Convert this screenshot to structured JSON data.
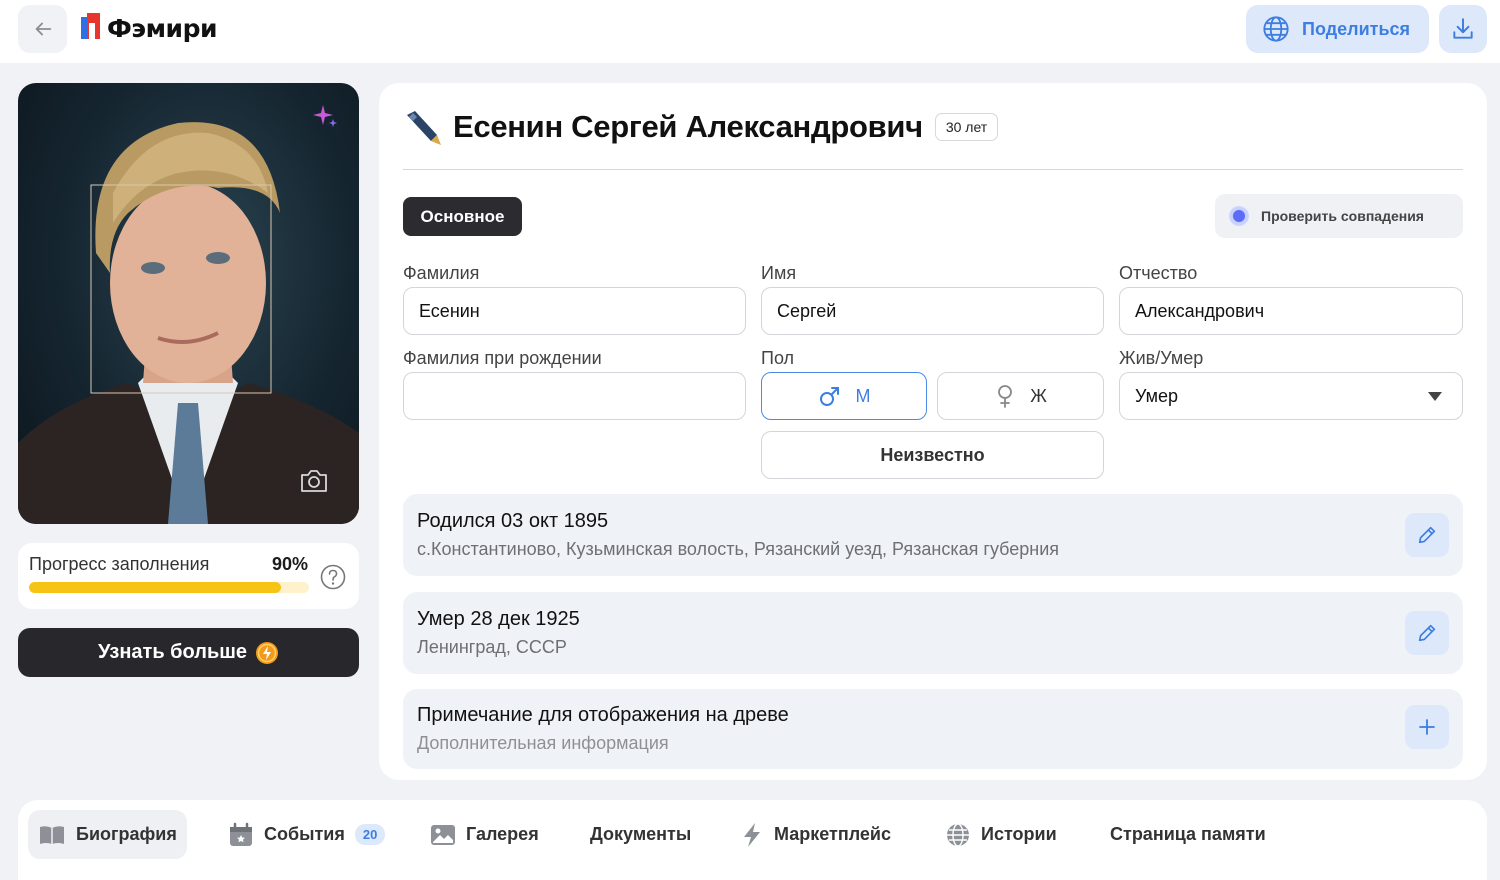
{
  "header": {
    "app_name": "Фэмири",
    "share_label": "Поделиться",
    "icons": {
      "back": "arrow-left-icon",
      "share": "globe-icon",
      "download": "download-icon"
    }
  },
  "sidebar": {
    "progress_label": "Прогресс заполнения",
    "progress_value": "90%",
    "progress_fraction": 0.9,
    "learn_more_label": "Узнать больше"
  },
  "profile": {
    "full_name": "Есенин Сергей Александрович",
    "age_badge": "30 лет",
    "tab_basic": "Основное",
    "check_matches_label": "Проверить совпадения",
    "fields": {
      "surname_label": "Фамилия",
      "surname_value": "Есенин",
      "name_label": "Имя",
      "name_value": "Сергей",
      "patronymic_label": "Отчество",
      "patronymic_value": "Александрович",
      "birth_surname_label": "Фамилия при рождении",
      "birth_surname_value": "",
      "gender_label": "Пол",
      "gender_male": "М",
      "gender_female": "Ж",
      "gender_unknown": "Неизвестно",
      "gender_selected": "М",
      "status_label": "Жив/Умер",
      "status_value": "Умер"
    },
    "events": [
      {
        "title": "Родился 03 окт 1895",
        "subtitle": "с.Константиново, Кузьминская волость, Рязанский уезд, Рязанская губерния",
        "action": "pencil-icon"
      },
      {
        "title": "Умер 28 дек 1925",
        "subtitle": "Ленинград, СССР",
        "action": "pencil-icon"
      },
      {
        "title": "Примечание для отображения на древе",
        "subtitle": "Дополнительная информация",
        "action": "plus-icon"
      }
    ]
  },
  "bottom_tabs": [
    {
      "label": "Биография",
      "icon": "book-icon",
      "active": true
    },
    {
      "label": "События",
      "icon": "calendar-icon",
      "badge": "20"
    },
    {
      "label": "Галерея",
      "icon": "image-icon"
    },
    {
      "label": "Документы"
    },
    {
      "label": "Маркетплейс",
      "icon": "lightning-icon"
    },
    {
      "label": "Истории",
      "icon": "globe-icon"
    },
    {
      "label": "Страница памяти"
    }
  ],
  "colors": {
    "accent": "#3d7ee0",
    "progress": "#f6c415",
    "dark_button": "#28282c"
  }
}
